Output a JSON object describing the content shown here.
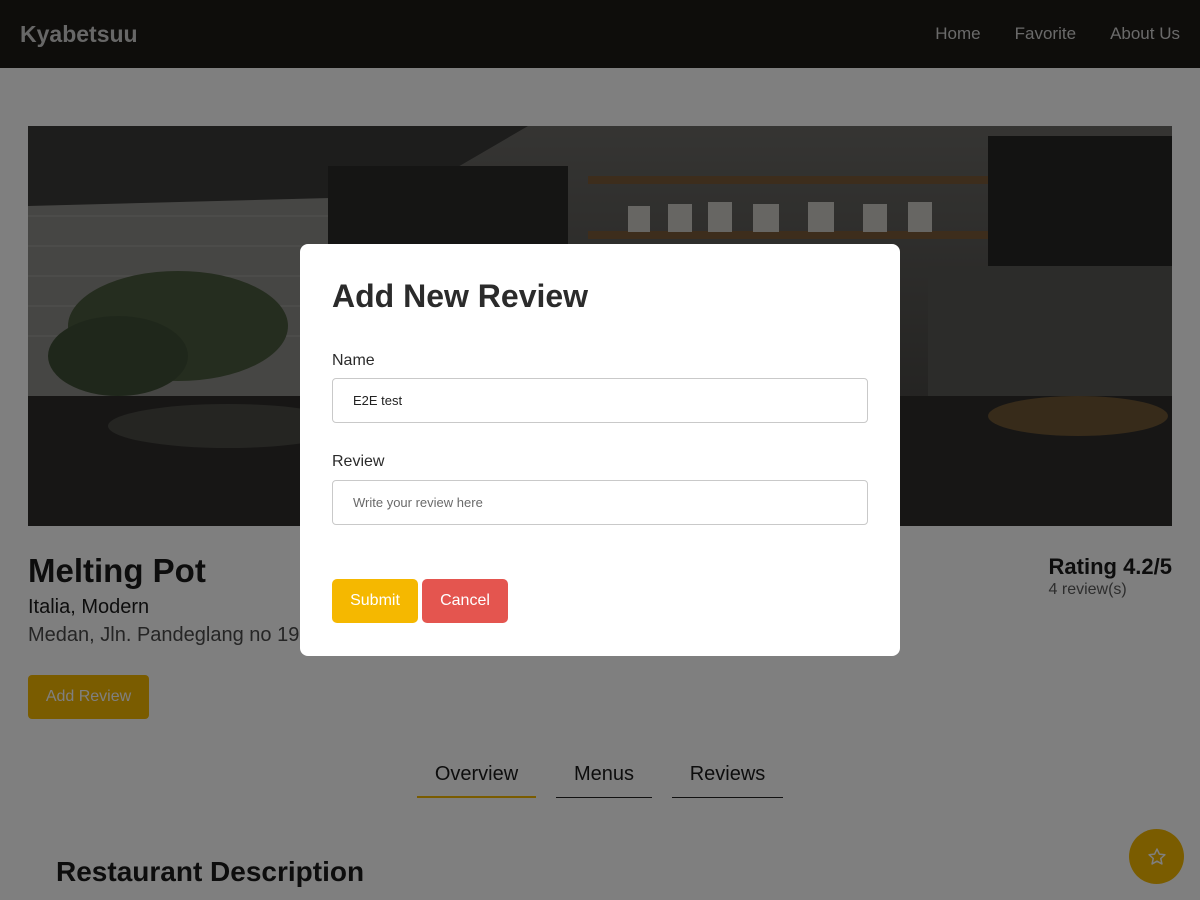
{
  "navbar": {
    "brand": "Kyabetsuu",
    "links": [
      "Home",
      "Favorite",
      "About Us"
    ]
  },
  "hero": {
    "image": "restaurant-kitchen-photo"
  },
  "restaurant": {
    "name": "Melting Pot",
    "categories": "Italia, Modern",
    "address": "Medan, Jln. Pandeglang no 19",
    "rating_label": "Rating 4.2/5",
    "review_count": "4 review(s)",
    "add_review_label": "Add Review"
  },
  "tabs": [
    "Overview",
    "Menus",
    "Reviews"
  ],
  "active_tab": "Overview",
  "section_title": "Restaurant Description",
  "fab": {
    "icon": "star-outline-icon"
  },
  "modal": {
    "title": "Add New Review",
    "name_label": "Name",
    "name_value": "E2E test",
    "review_label": "Review",
    "review_placeholder": "Write your review here",
    "review_value": "",
    "submit_label": "Submit",
    "cancel_label": "Cancel"
  },
  "colors": {
    "navbar_bg": "#1d1a16",
    "accent": "#f5b800",
    "danger": "#e4554f",
    "overlay": "rgba(0,0,0,0.5)"
  }
}
